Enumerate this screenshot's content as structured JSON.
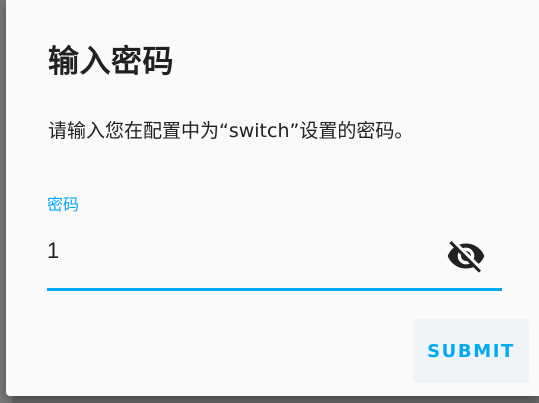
{
  "dialog": {
    "title": "输入密码",
    "message": "请输入您在配置中为“switch”设置的密码。",
    "password_field": {
      "label": "密码",
      "value": "1"
    },
    "visibility_icon": "eye-off-icon",
    "submit_label": "SUBMIT"
  },
  "colors": {
    "accent": "#03a9f4",
    "text": "#212121",
    "dialog_background": "#fafafa",
    "backdrop": "#6b6b6b"
  }
}
